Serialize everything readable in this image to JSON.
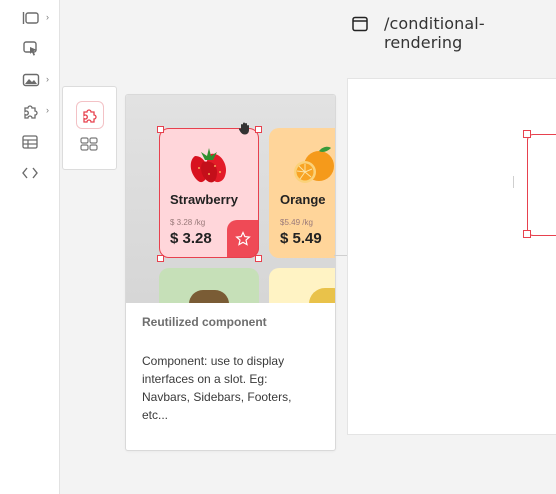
{
  "header": {
    "title": "/conditional-rendering"
  },
  "sidebar": {
    "items": [
      {
        "icon": "layout-icon",
        "has_submenu": true
      },
      {
        "icon": "cursor-click-icon",
        "has_submenu": false
      },
      {
        "icon": "image-icon",
        "has_submenu": true
      },
      {
        "icon": "puzzle-icon",
        "has_submenu": true
      },
      {
        "icon": "table-icon",
        "has_submenu": false
      },
      {
        "icon": "code-icon",
        "has_submenu": false
      }
    ]
  },
  "component_types": [
    {
      "icon": "puzzle-icon",
      "active": true
    },
    {
      "icon": "grid-icon",
      "active": false
    }
  ],
  "card": {
    "title": "Reutilized component",
    "description": "Component: use to display interfaces on a slot. Eg: Navbars, Sidebars, Footers, etc...",
    "preview": {
      "products": [
        {
          "name": "Strawberry",
          "unit_price": "$ 3.28 /kg",
          "price": "$ 3.28",
          "bg": "#ffd6da"
        },
        {
          "name": "Orange",
          "unit_price": "$5.49 /kg",
          "price": "$ 5.49",
          "bg": "#ffd59a"
        }
      ]
    }
  },
  "colors": {
    "accent": "#e7414e",
    "rail_bg": "#ffffff",
    "page_bg": "#f3f3f3"
  }
}
